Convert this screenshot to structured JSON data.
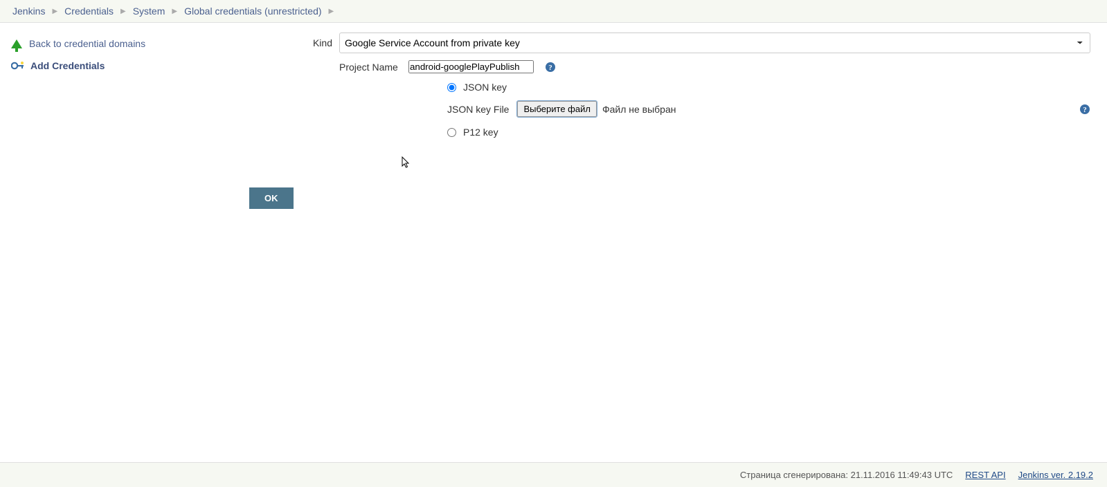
{
  "breadcrumb": [
    {
      "label": "Jenkins"
    },
    {
      "label": "Credentials"
    },
    {
      "label": "System"
    },
    {
      "label": "Global credentials (unrestricted)"
    }
  ],
  "sidebar": {
    "back_label": "Back to credential domains",
    "add_label": "Add Credentials"
  },
  "form": {
    "kind_label": "Kind",
    "kind_value": "Google Service Account from private key",
    "project_name_label": "Project Name",
    "project_name_value": "android-googlePlayPublish",
    "json_key_label": "JSON key",
    "json_file_label": "JSON key File",
    "file_button": "Выберите файл",
    "file_status": "Файл не выбран",
    "p12_key_label": "P12 key",
    "ok_label": "OK"
  },
  "footer": {
    "generated": "Страница сгенерирована: 21.11.2016 11:49:43 UTC",
    "rest_api": "REST API",
    "version": "Jenkins ver. 2.19.2"
  }
}
